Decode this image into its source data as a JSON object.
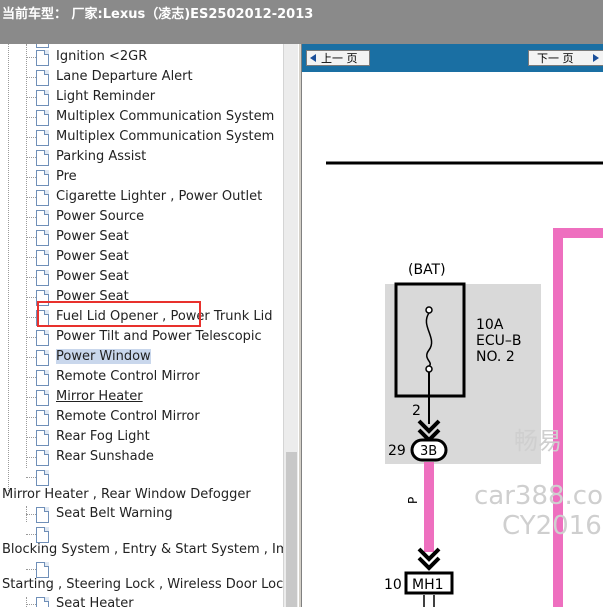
{
  "title": "当前车型： 厂家:Lexus（凌志)ES2502012-2013",
  "tree": {
    "items": [
      {
        "label": "Ignition <2GR",
        "indent": 56
      },
      {
        "label": "Lane Departure Alert",
        "indent": 56
      },
      {
        "label": "Light Reminder",
        "indent": 56
      },
      {
        "label": "Multiplex Communication System",
        "indent": 56
      },
      {
        "label": " Multiplex Communication System",
        "indent": 56
      },
      {
        "label": "Parking Assist",
        "indent": 56
      },
      {
        "label": " Pre",
        "indent": 56
      },
      {
        "label": "Cigarette Lighter , Power Outlet",
        "indent": 56
      },
      {
        "label": "Power Source",
        "indent": 56
      },
      {
        "label": "Power Seat",
        "indent": 56
      },
      {
        "label": "Power Seat",
        "indent": 56
      },
      {
        "label": "Power Seat",
        "indent": 56
      },
      {
        "label": " Power Seat",
        "indent": 56
      },
      {
        "label": "Fuel Lid Opener , Power Trunk Lid",
        "indent": 56
      },
      {
        "label": "Power Tilt and Power Telescopic",
        "indent": 56
      },
      {
        "label": "Power Window",
        "indent": 56,
        "selected": true
      },
      {
        "label": "Remote Control Mirror",
        "indent": 56
      },
      {
        "label": "Mirror Heater",
        "indent": 56,
        "underline": true
      },
      {
        "label": "Remote Control Mirror",
        "indent": 56
      },
      {
        "label": "Rear Fog Light",
        "indent": 56
      },
      {
        "label": "Rear Sunshade",
        "indent": 56
      },
      {
        "label": "",
        "indent": 56
      }
    ],
    "category_1": "Mirror Heater , Rear Window Defogger",
    "item_after_1": "Seat Belt Warning",
    "category_2": "Blocking System , Entry & Start System , Imm",
    "category_3": "Starting , Steering Lock , Wireless Door Lock",
    "item_after_3": "Seat Heater"
  },
  "viewer": {
    "prev_label": "上一 页",
    "next_label": "下一 页",
    "diagram": {
      "bat_label": "(BAT)",
      "fuse_rating": "10A",
      "fuse_name": "ECU–B",
      "fuse_no": "NO. 2",
      "pin_top": "2",
      "connector_pin": "29",
      "connector_name": "3B",
      "wire_color": "P",
      "pin_bottom": "10",
      "bottom_connector": "MH1",
      "watermark_1": "畅易",
      "watermark_2": "car388.co",
      "watermark_3": "CY2016"
    },
    "colors": {
      "wire": "#ee6fbf",
      "nav": "#1a6fa3",
      "highlight": "#e8312d"
    }
  }
}
